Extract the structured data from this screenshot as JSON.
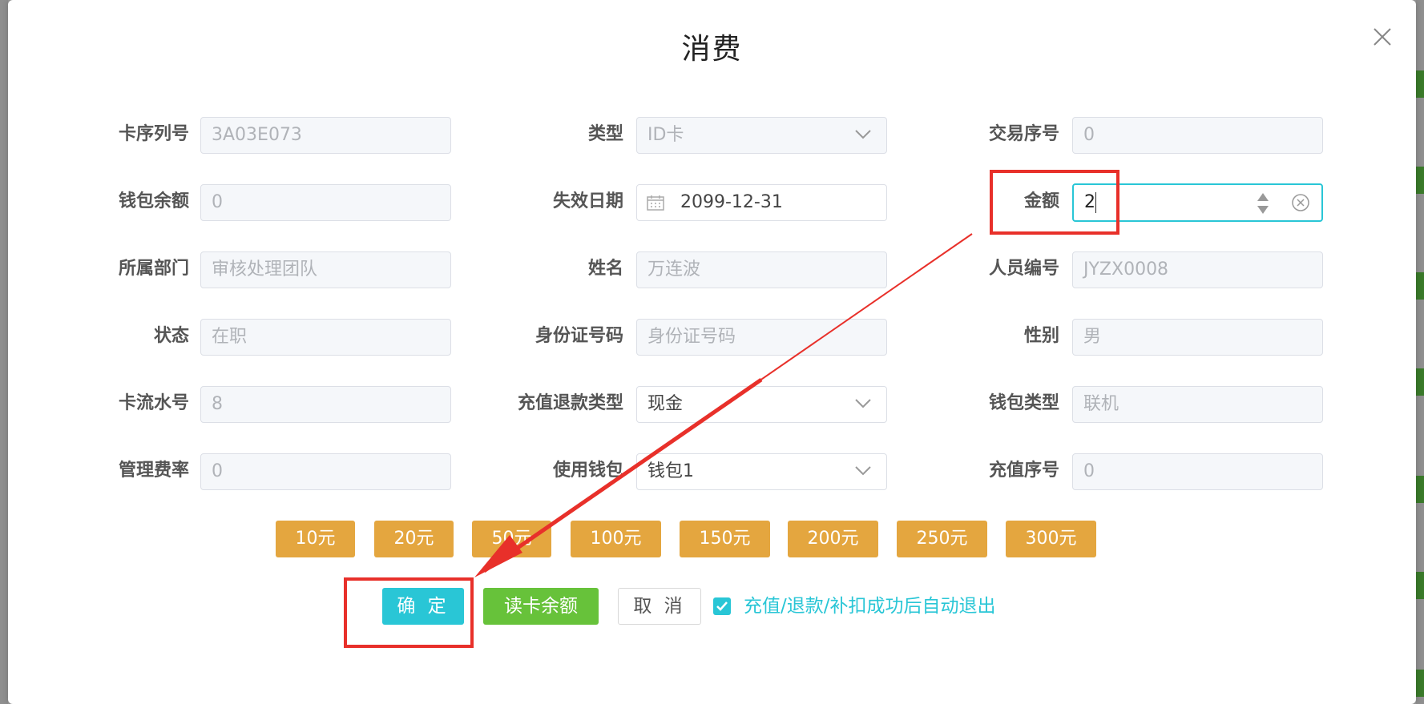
{
  "dialog": {
    "title": "消费"
  },
  "fields": {
    "card_serial": {
      "label": "卡序列号",
      "value": "3A03E073"
    },
    "card_type": {
      "label": "类型",
      "value": "ID卡"
    },
    "transaction_no": {
      "label": "交易序号",
      "value": "0"
    },
    "wallet_balance": {
      "label": "钱包余额",
      "value": "0"
    },
    "expiry_date": {
      "label": "失效日期",
      "value": "2099-12-31"
    },
    "amount": {
      "label": "金额",
      "value": "2"
    },
    "department": {
      "label": "所属部门",
      "placeholder": "审核处理团队"
    },
    "name": {
      "label": "姓名",
      "placeholder": "万连波"
    },
    "staff_no": {
      "label": "人员编号",
      "value": "JYZX0008"
    },
    "status": {
      "label": "状态",
      "value": "在职"
    },
    "id_number": {
      "label": "身份证号码",
      "placeholder": "身份证号码"
    },
    "gender": {
      "label": "性别",
      "value": "男"
    },
    "card_flow_no": {
      "label": "卡流水号",
      "value": "8"
    },
    "recharge_refund_type": {
      "label": "充值退款类型",
      "value": "现金"
    },
    "wallet_type": {
      "label": "钱包类型",
      "value": "联机"
    },
    "management_fee": {
      "label": "管理费率",
      "value": "0"
    },
    "use_wallet": {
      "label": "使用钱包",
      "value": "钱包1"
    },
    "recharge_no": {
      "label": "充值序号",
      "value": "0"
    }
  },
  "quick_amounts": [
    "10元",
    "20元",
    "50元",
    "100元",
    "150元",
    "200元",
    "250元",
    "300元"
  ],
  "actions": {
    "confirm": "确 定",
    "read_balance": "读卡余额",
    "cancel": "取 消",
    "auto_exit_label": "充值/退款/补扣成功后自动退出",
    "auto_exit_checked": true
  },
  "colors": {
    "accent": "#29c6d6",
    "quick_amount": "#e4a63f",
    "read_balance": "#67c23a",
    "annotation": "#e8302a"
  }
}
